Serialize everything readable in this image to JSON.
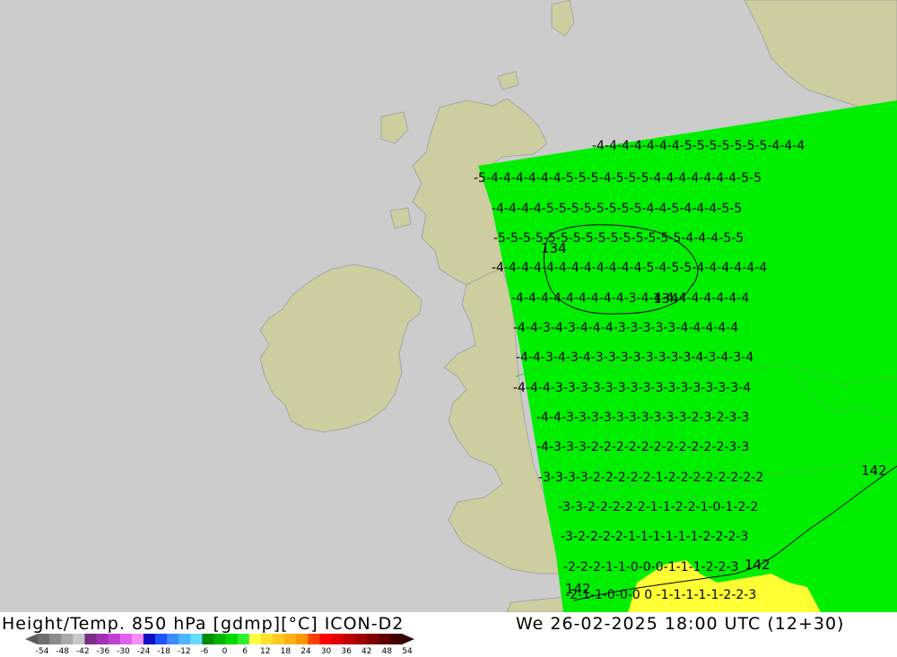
{
  "footer": {
    "title_left": "Height/Temp. 850 hPa [gdmp][°C] ICON-D2",
    "title_right": "We 26-02-2025 18:00 UTC (12+30)"
  },
  "colors": {
    "sea": "#cccccc",
    "land": "#cdcd9f",
    "coast": "#a6a6a6",
    "field_green": "#00ee00",
    "field_yellow": "#ffff33",
    "contour": "#000000"
  },
  "colorbar": {
    "ticks": [
      "-54",
      "-48",
      "-42",
      "-36",
      "-30",
      "-24",
      "-18",
      "-12",
      "-6",
      "0",
      "6",
      "12",
      "18",
      "24",
      "30",
      "36",
      "42",
      "48",
      "54"
    ],
    "colors": [
      "#6e6e6e",
      "#8c8c8c",
      "#aaaaaa",
      "#c8c8c8",
      "#7b2d84",
      "#a030b0",
      "#c040d0",
      "#e060f0",
      "#f090ff",
      "#1010c0",
      "#2050ff",
      "#3c8cff",
      "#50b4ff",
      "#64dcff",
      "#008c00",
      "#00b400",
      "#00d800",
      "#30ee30",
      "#ffff40",
      "#ffe030",
      "#ffc820",
      "#ffb010",
      "#ff9800",
      "#ff4000",
      "#ff0000",
      "#e00000",
      "#c00000",
      "#a00000",
      "#800000",
      "#600000",
      "#400000"
    ]
  },
  "isolines": [
    {
      "label": "-4-4-4-4-4-4-4-5-5-5-5-5-5-5-4-4-4"
    },
    {
      "label": "-5-4-4-4-4-4-4-5-5-5-4-5-5-5-4-4-4-4-4-4-4-5-5"
    },
    {
      "label": "-4-4-4-4-5-5-5-5-5-5-5-5-4-4-5-4-4-4-5-5"
    },
    {
      "label": "-5-5-5-5-5-5-5-5-5-5-5-5-5-5-5-4-4-4-5-5"
    },
    {
      "label": "-4-4-4-4-4-4-4-4-4-4-4-4-5-4-5-5-4-4-4-4-4-4"
    },
    {
      "label": "-4-4-4-4-4-4-4-4-4-3-4-4-4-4-4-4-4-4-4"
    },
    {
      "label": "-4-4-3-4-3-4-4-4-3-3-3-3-3-4-4-4-4-4"
    },
    {
      "label": "-4-4-3-4-3-4-3-3-3-3-3-3-3-3-4-3-4-3-4"
    },
    {
      "label": "-4-4-4-3-3-3-3-3-3-3-3-3-3-3-3-3-3-3-4"
    },
    {
      "label": "-4-4-3-3-3-3-3-3-3-3-3-3-2-3-2-3-3"
    },
    {
      "label": "-4-3-3-3-2-2-2-2-2-2-2-2-2-2-2-3-3"
    },
    {
      "label": "-3-3-3-3-2-2-2-2-2-1-2-2-2-2-2-2-2-2"
    },
    {
      "label": "-3-3-2-2-2-2-2-1-1-2-2-1-0-1-2-2"
    },
    {
      "label": "-3-2-2-2-2-1-1-1-1-1-1-2-2-2-3"
    },
    {
      "label": "-2-2-2-1-1-0-0-0-1-1-1-2-2-3"
    },
    {
      "label": "-2-1-1-0-0-0 0  -1-1-1-1-1-2-2-3"
    }
  ],
  "height_labels": [
    "134",
    "134",
    "142",
    "142",
    "142"
  ]
}
